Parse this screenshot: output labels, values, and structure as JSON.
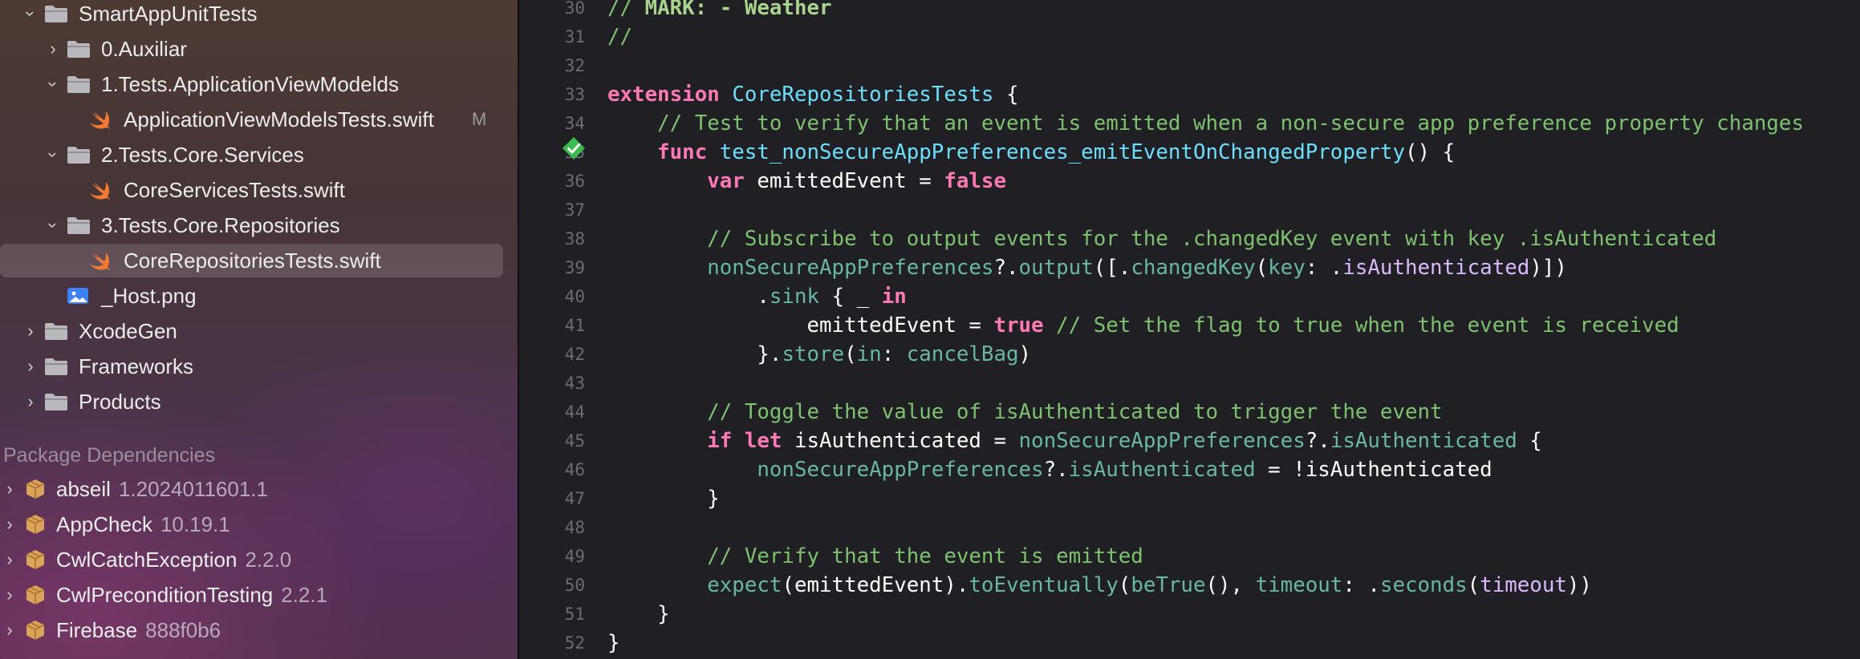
{
  "navigator": {
    "selected_file": "CoreRepositoriesTests.swift",
    "items": [
      {
        "label": "SmartAppUnitTests",
        "kind": "folder",
        "expanded": true,
        "icon": "folder-icon"
      },
      {
        "label": "0.Auxiliar",
        "kind": "folder",
        "expanded": false,
        "icon": "folder-icon"
      },
      {
        "label": "1.Tests.ApplicationViewModelds",
        "kind": "folder",
        "expanded": true,
        "icon": "folder-icon"
      },
      {
        "label": "ApplicationViewModelsTests.swift",
        "kind": "swift-file",
        "badge": "M",
        "icon": "swift-icon"
      },
      {
        "label": "2.Tests.Core.Services",
        "kind": "folder",
        "expanded": true,
        "icon": "folder-icon"
      },
      {
        "label": "CoreServicesTests.swift",
        "kind": "swift-file",
        "icon": "swift-icon"
      },
      {
        "label": "3.Tests.Core.Repositories",
        "kind": "folder",
        "expanded": true,
        "icon": "folder-icon"
      },
      {
        "label": "CoreRepositoriesTests.swift",
        "kind": "swift-file",
        "selected": true,
        "icon": "swift-icon"
      },
      {
        "label": "_Host.png",
        "kind": "image-file",
        "icon": "image-icon"
      },
      {
        "label": "XcodeGen",
        "kind": "folder",
        "expanded": false,
        "icon": "folder-icon"
      },
      {
        "label": "Frameworks",
        "kind": "folder",
        "expanded": false,
        "icon": "folder-icon"
      },
      {
        "label": "Products",
        "kind": "folder",
        "expanded": false,
        "icon": "folder-icon"
      }
    ],
    "package_dependencies": {
      "title": "Package Dependencies",
      "items": [
        {
          "name": "abseil",
          "version": "1.2024011601.1",
          "icon": "package-icon"
        },
        {
          "name": "AppCheck",
          "version": "10.19.1",
          "icon": "package-icon"
        },
        {
          "name": "CwlCatchException",
          "version": "2.2.0",
          "icon": "package-icon"
        },
        {
          "name": "CwlPreconditionTesting",
          "version": "2.2.1",
          "icon": "package-icon"
        },
        {
          "name": "Firebase",
          "version": "888f0b6",
          "icon": "package-icon"
        }
      ]
    }
  },
  "editor": {
    "test_status": "passed",
    "lines": [
      {
        "n": "30",
        "tokens": [
          [
            "comment",
            "// "
          ],
          [
            "mark",
            "MARK: - Weather"
          ]
        ]
      },
      {
        "n": "31",
        "tokens": [
          [
            "comment",
            "//"
          ]
        ]
      },
      {
        "n": "32",
        "tokens": []
      },
      {
        "n": "33",
        "tokens": [
          [
            "keyword",
            "extension"
          ],
          [
            "plain",
            " "
          ],
          [
            "type",
            "CoreRepositoriesTests"
          ],
          [
            "plain",
            " {"
          ]
        ]
      },
      {
        "n": "34",
        "tokens": [
          [
            "plain",
            "    "
          ],
          [
            "comment",
            "// Test to verify that an event is emitted when a non-secure app preference property changes"
          ]
        ]
      },
      {
        "n": "35",
        "tokens": [
          [
            "plain",
            "    "
          ],
          [
            "keyword",
            "func"
          ],
          [
            "plain",
            " "
          ],
          [
            "type",
            "test_nonSecureAppPreferences_emitEventOnChangedProperty"
          ],
          [
            "plain",
            "() {"
          ]
        ]
      },
      {
        "n": "36",
        "tokens": [
          [
            "plain",
            "        "
          ],
          [
            "keyword",
            "var"
          ],
          [
            "plain",
            " emittedEvent = "
          ],
          [
            "keyword",
            "false"
          ]
        ]
      },
      {
        "n": "37",
        "tokens": []
      },
      {
        "n": "38",
        "tokens": [
          [
            "plain",
            "        "
          ],
          [
            "comment",
            "// Subscribe to output events for the .changedKey event with key .isAuthenticated"
          ]
        ]
      },
      {
        "n": "39",
        "tokens": [
          [
            "plain",
            "        "
          ],
          [
            "member",
            "nonSecureAppPreferences"
          ],
          [
            "plain",
            "?."
          ],
          [
            "member",
            "output"
          ],
          [
            "plain",
            "([."
          ],
          [
            "member",
            "changedKey"
          ],
          [
            "plain",
            "("
          ],
          [
            "member",
            "key"
          ],
          [
            "plain",
            ": ."
          ],
          [
            "other",
            "isAuthenticated"
          ],
          [
            "plain",
            ")])"
          ]
        ]
      },
      {
        "n": "40",
        "tokens": [
          [
            "plain",
            "            ."
          ],
          [
            "member",
            "sink"
          ],
          [
            "plain",
            " { _ "
          ],
          [
            "keyword",
            "in"
          ]
        ]
      },
      {
        "n": "41",
        "tokens": [
          [
            "plain",
            "                emittedEvent = "
          ],
          [
            "keyword",
            "true"
          ],
          [
            "plain",
            " "
          ],
          [
            "comment",
            "// Set the flag to true when the event is received"
          ]
        ]
      },
      {
        "n": "42",
        "tokens": [
          [
            "plain",
            "            }."
          ],
          [
            "member",
            "store"
          ],
          [
            "plain",
            "("
          ],
          [
            "member",
            "in"
          ],
          [
            "plain",
            ": "
          ],
          [
            "member",
            "cancelBag"
          ],
          [
            "plain",
            ")"
          ]
        ]
      },
      {
        "n": "43",
        "tokens": []
      },
      {
        "n": "44",
        "tokens": [
          [
            "plain",
            "        "
          ],
          [
            "comment",
            "// Toggle the value of isAuthenticated to trigger the event"
          ]
        ]
      },
      {
        "n": "45",
        "tokens": [
          [
            "plain",
            "        "
          ],
          [
            "keyword",
            "if"
          ],
          [
            "plain",
            " "
          ],
          [
            "keyword",
            "let"
          ],
          [
            "plain",
            " isAuthenticated = "
          ],
          [
            "member",
            "nonSecureAppPreferences"
          ],
          [
            "plain",
            "?."
          ],
          [
            "member",
            "isAuthenticated"
          ],
          [
            "plain",
            " {"
          ]
        ]
      },
      {
        "n": "46",
        "tokens": [
          [
            "plain",
            "            "
          ],
          [
            "member",
            "nonSecureAppPreferences"
          ],
          [
            "plain",
            "?."
          ],
          [
            "member",
            "isAuthenticated"
          ],
          [
            "plain",
            " = !isAuthenticated"
          ]
        ]
      },
      {
        "n": "47",
        "tokens": [
          [
            "plain",
            "        }"
          ]
        ]
      },
      {
        "n": "48",
        "tokens": []
      },
      {
        "n": "49",
        "tokens": [
          [
            "plain",
            "        "
          ],
          [
            "comment",
            "// Verify that the event is emitted"
          ]
        ]
      },
      {
        "n": "50",
        "tokens": [
          [
            "plain",
            "        "
          ],
          [
            "member",
            "expect"
          ],
          [
            "plain",
            "(emittedEvent)."
          ],
          [
            "member",
            "toEventually"
          ],
          [
            "plain",
            "("
          ],
          [
            "member",
            "beTrue"
          ],
          [
            "plain",
            "(), "
          ],
          [
            "member",
            "timeout"
          ],
          [
            "plain",
            ": ."
          ],
          [
            "member",
            "seconds"
          ],
          [
            "plain",
            "("
          ],
          [
            "other",
            "timeout"
          ],
          [
            "plain",
            "))"
          ]
        ]
      },
      {
        "n": "51",
        "tokens": [
          [
            "plain",
            "    }"
          ]
        ]
      },
      {
        "n": "52",
        "tokens": [
          [
            "plain",
            "}"
          ]
        ]
      }
    ]
  }
}
